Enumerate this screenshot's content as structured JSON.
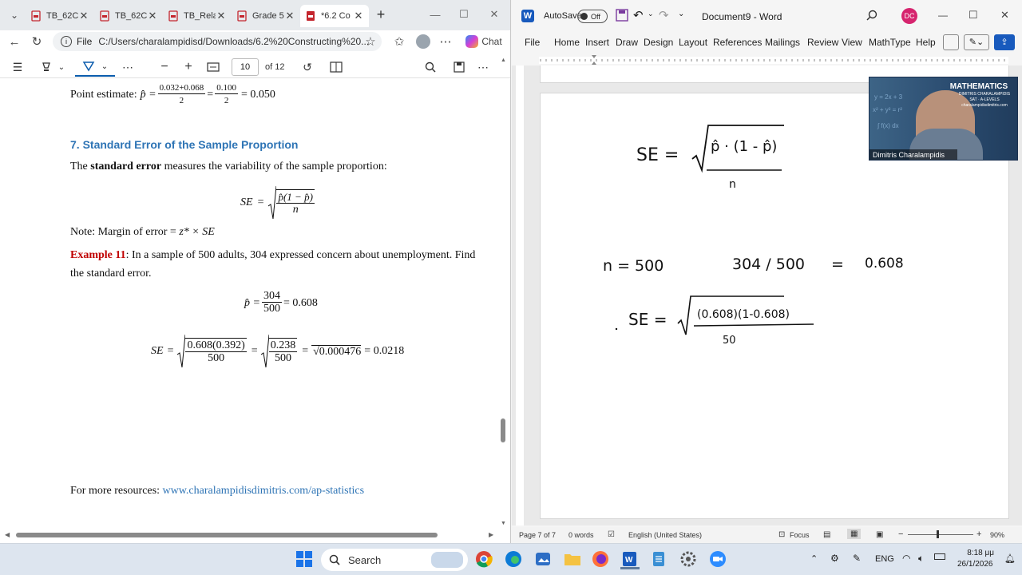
{
  "browser": {
    "tabs": [
      {
        "label": "TB_62C(",
        "active": false
      },
      {
        "label": "TB_62C(",
        "active": false
      },
      {
        "label": "TB_Rela",
        "active": false
      },
      {
        "label": "Grade 5",
        "active": false
      },
      {
        "label": "*6.2 Co",
        "active": true
      }
    ],
    "address": {
      "scheme_label": "File",
      "url": "C:/Users/charalampidisd/Downloads/6.2%20Constructing%20..."
    },
    "copilot_label": "Chat",
    "pdf_toolbar": {
      "page_number": "10",
      "page_count": "of 12"
    },
    "pdf": {
      "point_estimate_label": "Point estimate:",
      "point_estimate_num1": "0.032+0.068",
      "point_estimate_den": "2",
      "point_estimate_num2": "0.100",
      "point_estimate_result": "= 0.050",
      "section_title": "7. Standard Error of the Sample Proportion",
      "intro_prefix": "The ",
      "intro_bold": "standard error",
      "intro_rest": " measures the variability of the sample proportion:",
      "se_symbol": "SE",
      "se_formula_num": "p̂(1 − p̂)",
      "se_formula_den": "n",
      "note_text": "Note: Margin of error = ",
      "note_formula": "z* × SE",
      "example_label": "Example 11",
      "example_text": ": In a sample of 500 adults, 304 expressed concern about unemployment. Find the standard error.",
      "phat_num": "304",
      "phat_den": "500",
      "phat_result": "= 0.608",
      "calc_num1": "0.608(0.392)",
      "calc_den1": "500",
      "calc_num2": "0.238",
      "calc_den2": "500",
      "calc_sqrt": "0.000476",
      "calc_result": "= 0.0218",
      "resources_label": "For more resources: ",
      "resources_link": "www.charalampidisdimitris.com/ap-statistics"
    }
  },
  "word": {
    "autosave_label": "AutoSave",
    "autosave_state": "Off",
    "doc_title": "Document9 - Word",
    "user_initials": "DC",
    "menu": [
      "File",
      "Home",
      "Insert",
      "Draw",
      "Design",
      "Layout",
      "References",
      "Mailings",
      "Review",
      "View",
      "MathType",
      "Help"
    ],
    "status": {
      "page": "Page 7 of 7",
      "words": "0 words",
      "language": "English (United States)",
      "focus": "Focus",
      "zoom": "90%"
    },
    "handwriting": {
      "se_label": "SE =",
      "se_num": "p̂ · (1 - p̂)",
      "se_den": "n",
      "n_eq": "n = 500",
      "ratio": "304 / 500",
      "eq": "=",
      "ratio_val": "0.608",
      "se2_label": "SE =",
      "se2_num": "(0.608)(1-0.608)",
      "se2_den": "50"
    },
    "webcam": {
      "title": "MATHEMATICS",
      "subtitle": "DIMITRIS CHARALAMPIDIS",
      "tagline": "SAT · A-LEVELS",
      "site": "charalampidisdimitris.com",
      "name": "Dimitris Charalampidis"
    }
  },
  "taskbar": {
    "search_label": "Search",
    "language": "ENG",
    "time": "8:18 μμ",
    "date": "26/1/2026"
  },
  "colors": {
    "section_blue": "#2e74b5",
    "example_red": "#c00000",
    "word_blue": "#185abd"
  }
}
